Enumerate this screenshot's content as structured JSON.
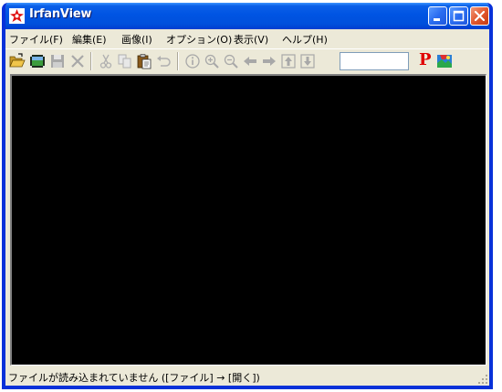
{
  "window": {
    "title": "IrfanView"
  },
  "menu": {
    "items": [
      "ファイル(F)",
      "編集(E)",
      "画像(I)",
      "オプション(O)",
      "表示(V)",
      "ヘルプ(H)"
    ]
  },
  "toolbar": {
    "buttons": [
      {
        "name": "open-icon",
        "enabled": true
      },
      {
        "name": "slideshow-icon",
        "enabled": true
      },
      {
        "name": "save-icon",
        "enabled": false
      },
      {
        "name": "delete-icon",
        "enabled": false
      },
      {
        "name": "cut-icon",
        "enabled": false
      },
      {
        "name": "copy-icon",
        "enabled": false
      },
      {
        "name": "paste-icon",
        "enabled": true
      },
      {
        "name": "undo-icon",
        "enabled": false
      },
      {
        "name": "info-icon",
        "enabled": false
      },
      {
        "name": "zoom-in-icon",
        "enabled": false
      },
      {
        "name": "zoom-out-icon",
        "enabled": false
      },
      {
        "name": "previous-icon",
        "enabled": false
      },
      {
        "name": "next-icon",
        "enabled": false
      },
      {
        "name": "first-icon",
        "enabled": false
      },
      {
        "name": "last-icon",
        "enabled": false
      },
      {
        "name": "print-icon",
        "enabled": true
      },
      {
        "name": "irfanview-logo-icon",
        "enabled": true
      }
    ],
    "input_value": "",
    "print_label": "P"
  },
  "status": {
    "text": "ファイルが読み込まれていません ([ファイル] → [開く])"
  },
  "colors": {
    "titlebar": "#0054e3",
    "canvas": "#000000",
    "chrome": "#ece9d8"
  }
}
